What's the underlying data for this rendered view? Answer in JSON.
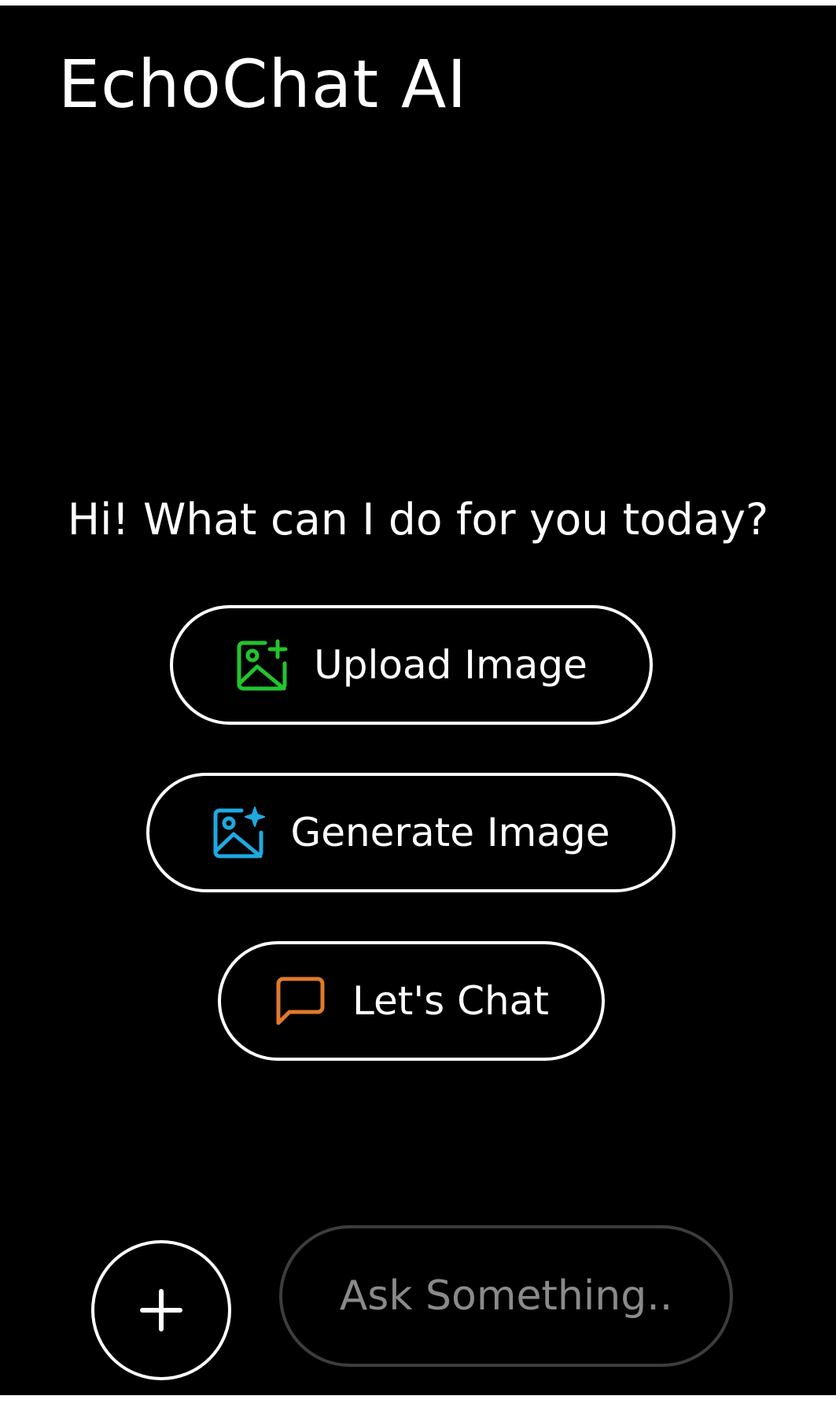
{
  "header": {
    "title": "EchoChat AI"
  },
  "main": {
    "greeting": "Hi! What can I do for you today?",
    "actions": [
      {
        "label": "Upload Image",
        "icon": "image-plus-icon",
        "color": "#22c52e"
      },
      {
        "label": "Generate Image",
        "icon": "image-sparkle-icon",
        "color": "#1fa9e0"
      },
      {
        "label": "Let's Chat",
        "icon": "chat-bubble-icon",
        "color": "#e07a2c"
      }
    ]
  },
  "composer": {
    "add_icon": "plus-icon",
    "placeholder": "Ask Something..",
    "value": ""
  }
}
